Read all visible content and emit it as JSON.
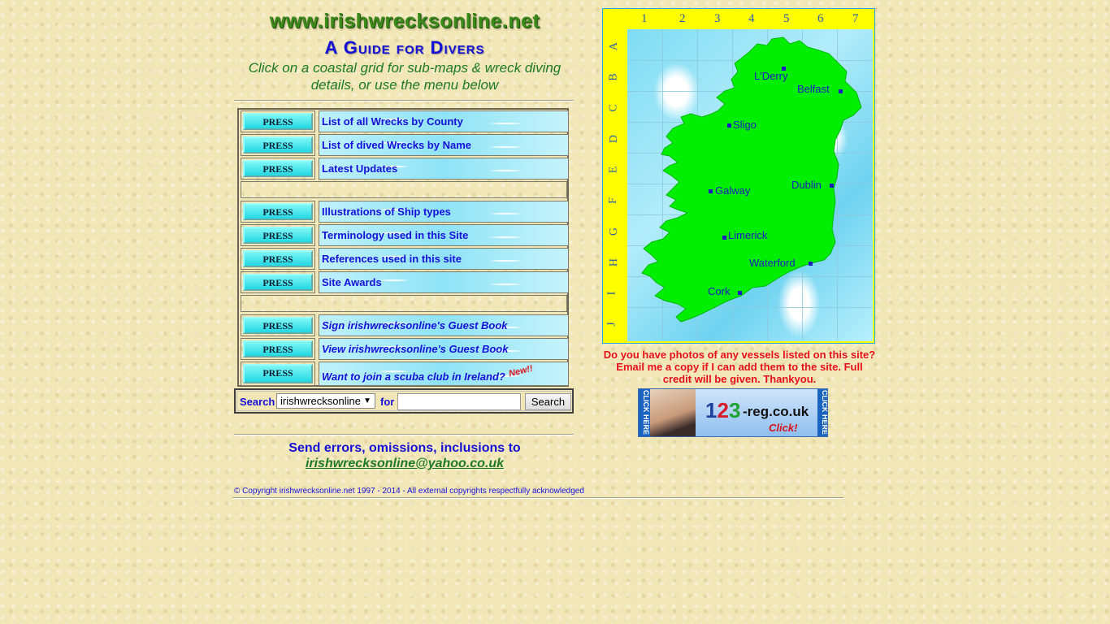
{
  "header": {
    "site_url": "www.irishwrecksonline.net",
    "title": "A Guide for Divers",
    "subtitle": "Click on a coastal grid for sub-maps & wreck diving details, or use the menu below"
  },
  "menu": {
    "press_label": "PRESS",
    "items": [
      {
        "label": "List of all Wrecks by County"
      },
      {
        "label": "List of dived Wrecks by Name"
      },
      {
        "label": "Latest Updates"
      },
      {
        "label": "Illustrations of Ship types"
      },
      {
        "label": "Terminology used in this Site"
      },
      {
        "label": "References used in this site"
      },
      {
        "label": "Site Awards"
      },
      {
        "label": "Sign irishwrecksonline's Guest Book"
      },
      {
        "label": "View irishwrecksonline's Guest Book"
      },
      {
        "label": "Want to join a scuba club in Ireland?"
      }
    ],
    "new_badge": "New!!"
  },
  "search": {
    "label": "Search",
    "scope_value": "irishwrecksonline",
    "for_label": "for",
    "input_value": "",
    "button_label": "Search"
  },
  "footer": {
    "send_errors": "Send errors, omissions, inclusions to",
    "email": "irishwrecksonline@yahoo.co.uk",
    "copyright": "© Copyright irishwrecksonline.net 1997 - 2014 - All external copyrights respectfully acknowledged"
  },
  "map": {
    "columns": [
      "1",
      "2",
      "3",
      "4",
      "5",
      "6",
      "7"
    ],
    "rows": [
      "A",
      "B",
      "C",
      "D",
      "E",
      "F",
      "G",
      "H",
      "I",
      "J"
    ],
    "cities": [
      "L'Derry",
      "Belfast",
      "Sligo",
      "Galway",
      "Dublin",
      "Limerick",
      "Waterford",
      "Cork"
    ]
  },
  "notice": {
    "photos": "Do you have photos of any vessels listed on this site? Email me a copy if I can add them to the site. Full credit will be given. Thankyou."
  },
  "ad": {
    "side_text": "CLICK HERE",
    "logo_1": "1",
    "logo_2": "2",
    "logo_3": "3",
    "domain": "-reg.co.uk",
    "click": "Click!"
  },
  "colors": {
    "background": "#f1e6b5",
    "link_blue": "#1610d8",
    "title_green": "#3c8a1a",
    "press_cyan": "#23d9e4",
    "map_yellow": "#ffff00",
    "land_green": "#00ee00",
    "notice_red": "#e5101a"
  }
}
